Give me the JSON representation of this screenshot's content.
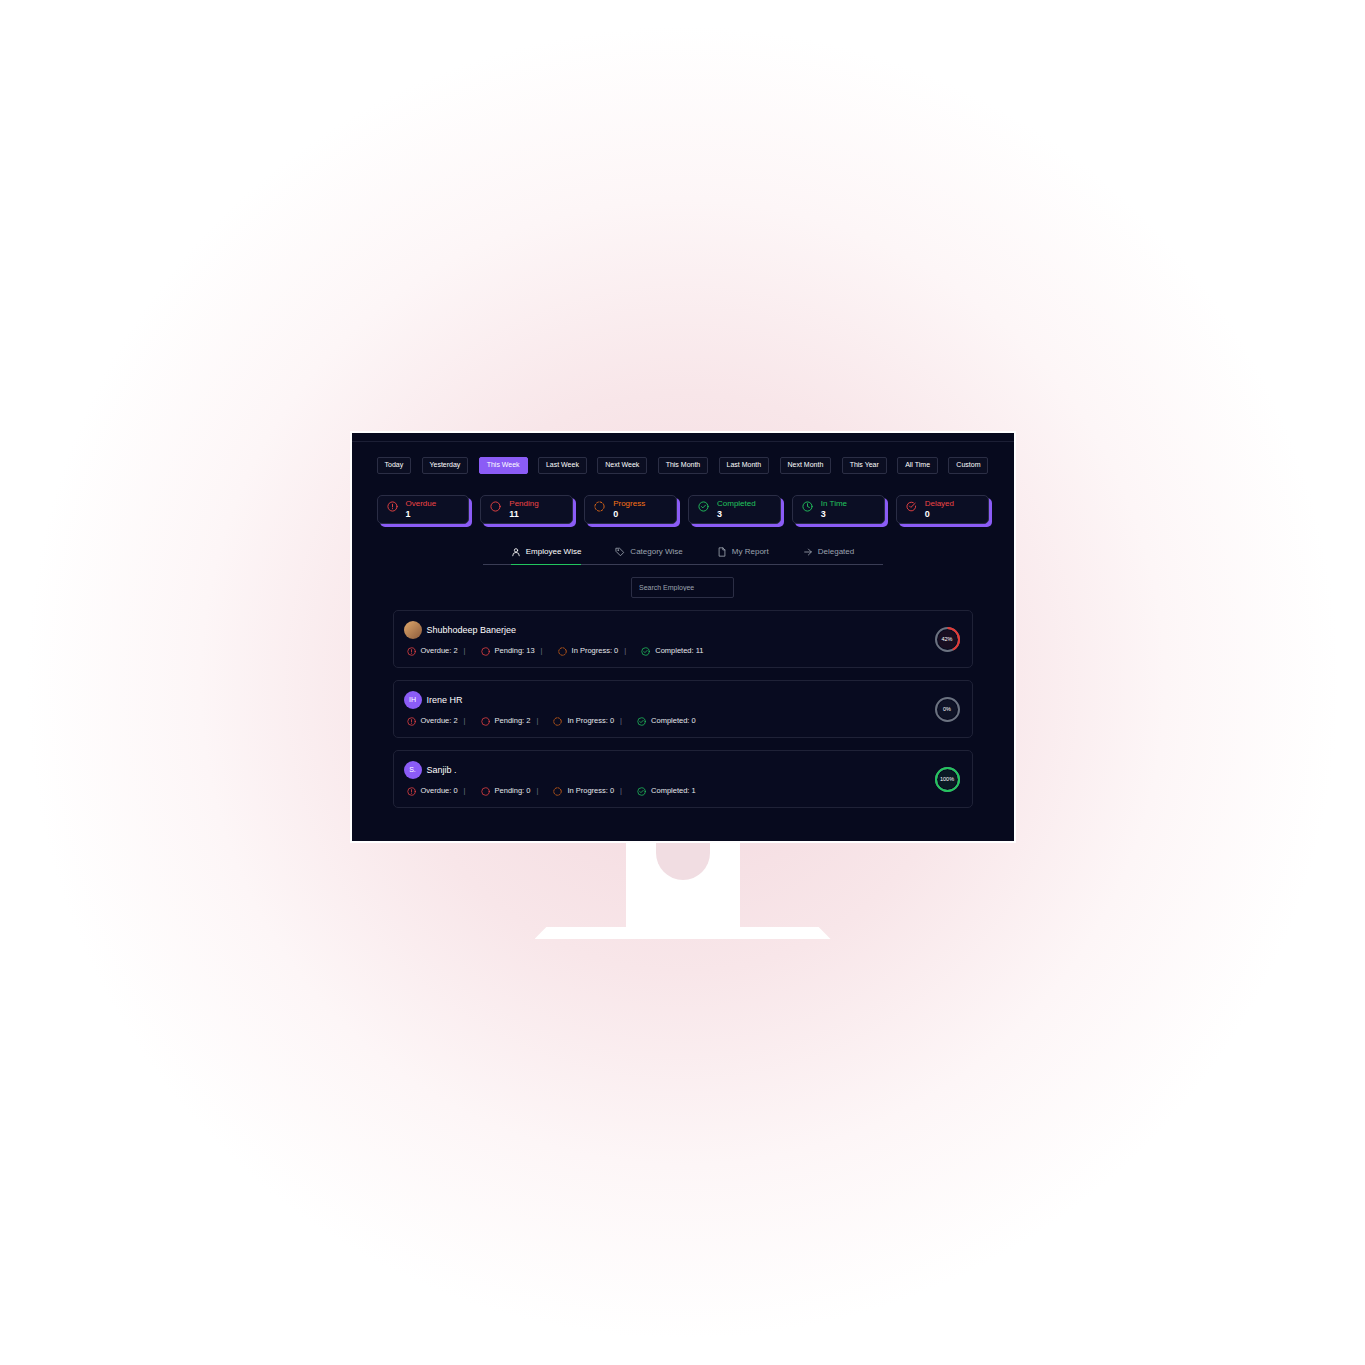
{
  "filters": [
    {
      "label": "Today",
      "selected": false
    },
    {
      "label": "Yesterday",
      "selected": false
    },
    {
      "label": "This Week",
      "selected": true
    },
    {
      "label": "Last Week",
      "selected": false
    },
    {
      "label": "Next Week",
      "selected": false
    },
    {
      "label": "This Month",
      "selected": false
    },
    {
      "label": "Last Month",
      "selected": false
    },
    {
      "label": "Next Month",
      "selected": false
    },
    {
      "label": "This Year",
      "selected": false
    },
    {
      "label": "All Time",
      "selected": false
    },
    {
      "label": "Custom",
      "selected": false
    }
  ],
  "stats": [
    {
      "label": "Overdue",
      "value": "1",
      "kind": "overdue",
      "color": "#ef4444"
    },
    {
      "label": "Pending",
      "value": "11",
      "kind": "pending",
      "color": "#ef4444"
    },
    {
      "label": "Progress",
      "value": "0",
      "kind": "progress",
      "color": "#f97316"
    },
    {
      "label": "Completed",
      "value": "3",
      "kind": "completed",
      "color": "#22c55e"
    },
    {
      "label": "In Time",
      "value": "3",
      "kind": "intime",
      "color": "#22c55e"
    },
    {
      "label": "Delayed",
      "value": "0",
      "kind": "delayed",
      "color": "#ef4444"
    }
  ],
  "views": [
    {
      "label": "Employee Wise",
      "selected": true,
      "kind": "person"
    },
    {
      "label": "Category Wise",
      "selected": false,
      "kind": "tag"
    },
    {
      "label": "My Report",
      "selected": false,
      "kind": "document"
    },
    {
      "label": "Delegated",
      "selected": false,
      "kind": "arrow"
    }
  ],
  "search": {
    "placeholder": "Search Employee"
  },
  "separator": "|",
  "employees": [
    {
      "name": "Shubhodeep Banerjee",
      "avatar": {
        "kind": "photo"
      },
      "stats": [
        {
          "kind": "overdue",
          "text": "Overdue: 2"
        },
        {
          "kind": "pending",
          "text": "Pending: 13"
        },
        {
          "kind": "progress",
          "text": "In Progress: 0"
        },
        {
          "kind": "completed",
          "text": "Completed: 11"
        }
      ],
      "percent": "42%",
      "level": 0.42,
      "color": "#e53935"
    },
    {
      "name": "Irene HR",
      "avatar": {
        "kind": "initials",
        "text": "IH"
      },
      "stats": [
        {
          "kind": "overdue",
          "text": "Overdue: 2"
        },
        {
          "kind": "pending",
          "text": "Pending: 2"
        },
        {
          "kind": "progress",
          "text": "In Progress: 0"
        },
        {
          "kind": "completed",
          "text": "Completed: 0"
        }
      ],
      "percent": "0%",
      "level": 0,
      "color": "#6b7280"
    },
    {
      "name": "Sanjib .",
      "avatar": {
        "kind": "initials",
        "text": "S."
      },
      "stats": [
        {
          "kind": "overdue",
          "text": "Overdue: 0"
        },
        {
          "kind": "pending",
          "text": "Pending: 0"
        },
        {
          "kind": "progress",
          "text": "In Progress: 0"
        },
        {
          "kind": "completed",
          "text": "Completed: 1"
        }
      ],
      "percent": "100%",
      "level": 1,
      "color": "#22c55e"
    }
  ]
}
